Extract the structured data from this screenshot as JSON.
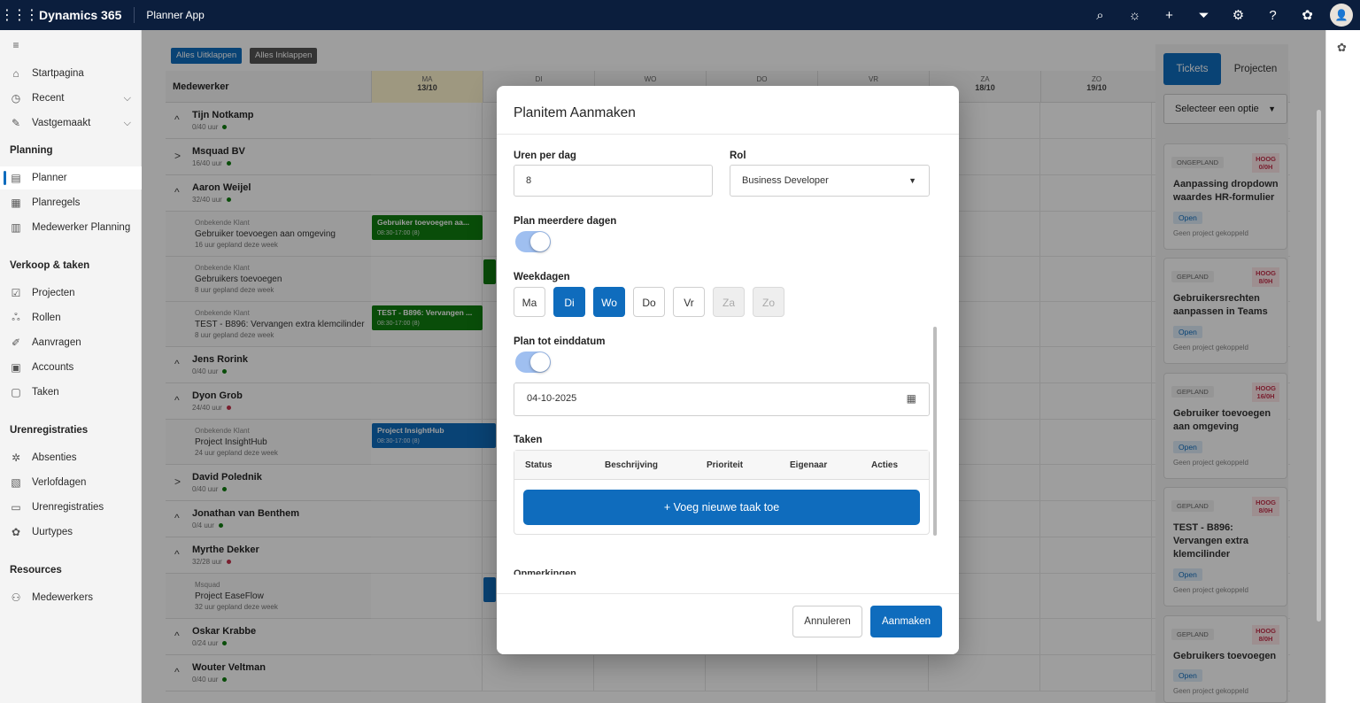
{
  "topbar": {
    "waffle": "⋮⋮⋮",
    "brand": "Dynamics 365",
    "app": "Planner App",
    "avatar": "👤"
  },
  "sidebar": {
    "menu_icon": "≡",
    "items_top": [
      {
        "label": "Startpagina",
        "icon": "⌂"
      },
      {
        "label": "Recent",
        "icon": "◷",
        "chev": "⌵"
      },
      {
        "label": "Vastgemaakt",
        "icon": "✎",
        "chev": "⌵"
      }
    ],
    "section_planning": "Planning",
    "planning": [
      {
        "label": "Planner",
        "icon": "▤"
      },
      {
        "label": "Planregels",
        "icon": "▦"
      },
      {
        "label": "Medewerker Planning",
        "icon": "▥"
      }
    ],
    "section_verkoop": "Verkoop & taken",
    "verkoop": [
      {
        "label": "Projecten",
        "icon": "☑"
      },
      {
        "label": "Rollen",
        "icon": "ஃ"
      },
      {
        "label": "Aanvragen",
        "icon": "✐"
      },
      {
        "label": "Accounts",
        "icon": "▣"
      },
      {
        "label": "Taken",
        "icon": "▢"
      }
    ],
    "section_uren": "Urenregistraties",
    "uren": [
      {
        "label": "Absenties",
        "icon": "✲"
      },
      {
        "label": "Verlofdagen",
        "icon": "▧"
      },
      {
        "label": "Urenregistraties",
        "icon": "▭"
      },
      {
        "label": "Uurtypes",
        "icon": "✿"
      }
    ],
    "section_res": "Resources",
    "res": [
      {
        "label": "Medewerkers",
        "icon": "⚇"
      }
    ]
  },
  "planner": {
    "expand_all": "Alles Uitklappen",
    "collapse_all": "Alles Inklappen",
    "col_header": "Medewerker",
    "days": [
      {
        "d": "MA",
        "date": "13/10"
      },
      {
        "d": "DI",
        "date": ""
      },
      {
        "d": "WO",
        "date": ""
      },
      {
        "d": "DO",
        "date": ""
      },
      {
        "d": "VR",
        "date": ""
      },
      {
        "d": "ZA",
        "date": "18/10"
      },
      {
        "d": "ZO",
        "date": "19/10"
      }
    ],
    "employees": [
      {
        "arrow": "^",
        "name": "Tijn Notkamp",
        "hours": "0/40 uur"
      },
      {
        "arrow": ">",
        "name": "Msquad BV",
        "hours": "16/40 uur"
      },
      {
        "arrow": "^",
        "name": "Aaron Weijel",
        "hours": "32/40 uur"
      },
      {
        "arrow": "^",
        "name": "Jens Rorink",
        "hours": "0/40 uur"
      },
      {
        "arrow": "^",
        "name": "Dyon Grob",
        "hours": "24/40 uur"
      },
      {
        "arrow": ">",
        "name": "David Polednik",
        "hours": "0/40 uur"
      },
      {
        "arrow": "^",
        "name": "Jonathan van Benthem",
        "hours": "0/4 uur"
      },
      {
        "arrow": "^",
        "name": "Myrthe Dekker",
        "hours": "32/28 uur"
      },
      {
        "arrow": "^",
        "name": "Oskar Krabbe",
        "hours": "0/24 uur"
      },
      {
        "arrow": "^",
        "name": "Wouter Veltman",
        "hours": "0/40 uur"
      }
    ],
    "subrows": [
      {
        "client": "Onbekende Klant",
        "desc": "Gebruiker toevoegen aan omgeving",
        "hours": "16 uur gepland deze week"
      },
      {
        "client": "Onbekende Klant",
        "desc": "Gebruikers toevoegen",
        "hours": "8 uur gepland deze week"
      },
      {
        "client": "Onbekende Klant",
        "desc": "TEST - B896: Vervangen extra klemcilinder",
        "hours": "8 uur gepland deze week"
      },
      {
        "client": "Onbekende Klant",
        "desc": "Project InsightHub",
        "hours": "24 uur gepland deze week"
      },
      {
        "client": "Msquad",
        "desc": "Project EaseFlow",
        "hours": "32 uur gepland deze week"
      }
    ],
    "bars": [
      {
        "title": "Gebruiker toevoegen aa...",
        "time": "08:30-17:00 (8)"
      },
      {
        "title": "TEST - B896: Vervangen ...",
        "time": "08:30-17:00 (8)"
      },
      {
        "title": "Project InsightHub",
        "time": "08:30-17:00 (8)"
      }
    ]
  },
  "right_panel": {
    "tab_tickets": "Tickets",
    "tab_projects": "Projecten",
    "select": "Selecteer een optie",
    "select_arrow": "▼",
    "cards": [
      {
        "status": "ONGEPLAND",
        "prio": "HOOG",
        "prio_h": "0/0H",
        "title": "Aanpassing dropdown waardes HR-formulier",
        "open": "Open",
        "project": "Geen project gekoppeld"
      },
      {
        "status": "GEPLAND",
        "prio": "HOOG",
        "prio_h": "8/0H",
        "title": "Gebruikersrechten aanpassen in Teams",
        "open": "Open",
        "project": "Geen project gekoppeld"
      },
      {
        "status": "GEPLAND",
        "prio": "HOOG",
        "prio_h": "16/0H",
        "title": "Gebruiker toevoegen aan omgeving",
        "open": "Open",
        "project": "Geen project gekoppeld"
      },
      {
        "status": "GEPLAND",
        "prio": "HOOG",
        "prio_h": "8/0H",
        "title": "TEST - B896: Vervangen extra klemcilinder",
        "open": "Open",
        "project": "Geen project gekoppeld"
      },
      {
        "status": "GEPLAND",
        "prio": "HOOG",
        "prio_h": "8/0H",
        "title": "Gebruikers toevoegen",
        "open": "Open",
        "project": "Geen project gekoppeld"
      }
    ]
  },
  "modal": {
    "title": "Planitem Aanmaken",
    "hours_label": "Uren per dag",
    "hours_value": "8",
    "role_label": "Rol",
    "role_value": "Business Developer",
    "role_arrow": "▼",
    "multi_label": "Plan meerdere dagen",
    "weekdays_label": "Weekdagen",
    "weekdays": [
      {
        "l": "Ma",
        "s": "normal"
      },
      {
        "l": "Di",
        "s": "on"
      },
      {
        "l": "Wo",
        "s": "on"
      },
      {
        "l": "Do",
        "s": "normal"
      },
      {
        "l": "Vr",
        "s": "normal"
      },
      {
        "l": "Za",
        "s": "off"
      },
      {
        "l": "Zo",
        "s": "off"
      }
    ],
    "enddate_label": "Plan tot einddatum",
    "date_value": "04-10-2025",
    "cal_icon": "▦",
    "tasks_label": "Taken",
    "tasks_cols": [
      "Status",
      "Beschrijving",
      "Prioriteit",
      "Eigenaar",
      "Acties"
    ],
    "add_task": "+ Voeg nieuwe taak toe",
    "remarks_label": "Opmerkingen",
    "cancel": "Annuleren",
    "create": "Aanmaken"
  },
  "colors": {
    "brand": "#0b1e3d",
    "accent": "#0f6cbd",
    "green": "#107c10",
    "red": "#c4314b"
  }
}
